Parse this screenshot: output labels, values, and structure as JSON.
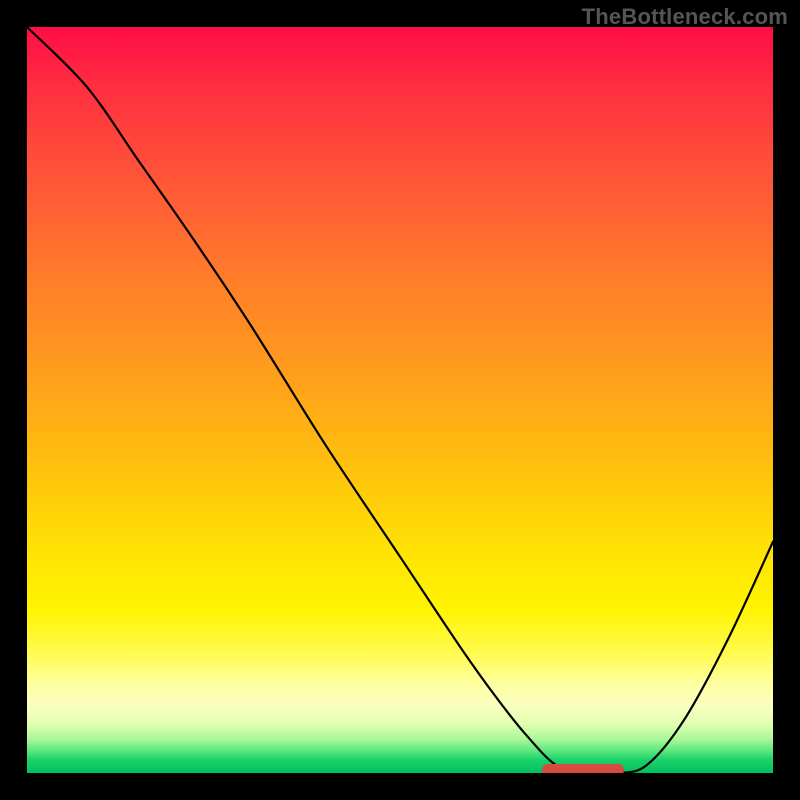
{
  "attribution": "TheBottleneck.com",
  "chart_data": {
    "type": "line",
    "title": "",
    "xlabel": "",
    "ylabel": "",
    "xlim": [
      0,
      100
    ],
    "ylim": [
      0,
      100
    ],
    "grid": false,
    "series": [
      {
        "name": "bottleneck-curve",
        "x": [
          0,
          8,
          15,
          22,
          30,
          40,
          50,
          58,
          63,
          67,
          71,
          75,
          79,
          83,
          88,
          94,
          100
        ],
        "values": [
          100,
          92,
          82,
          72,
          60,
          44,
          29,
          17,
          10,
          5,
          1,
          0,
          0,
          1,
          7,
          18,
          31
        ]
      }
    ],
    "annotations": [
      {
        "name": "optimal-marker-bar",
        "x_start": 69,
        "x_end": 80,
        "y": 0,
        "color": "#d94a3f"
      }
    ],
    "background": {
      "type": "vertical-gradient",
      "stops": [
        {
          "pos": 0.0,
          "color": "#ff0d45"
        },
        {
          "pos": 0.5,
          "color": "#ffa21a"
        },
        {
          "pos": 0.8,
          "color": "#fff400"
        },
        {
          "pos": 1.0,
          "color": "#00c060"
        }
      ]
    }
  }
}
